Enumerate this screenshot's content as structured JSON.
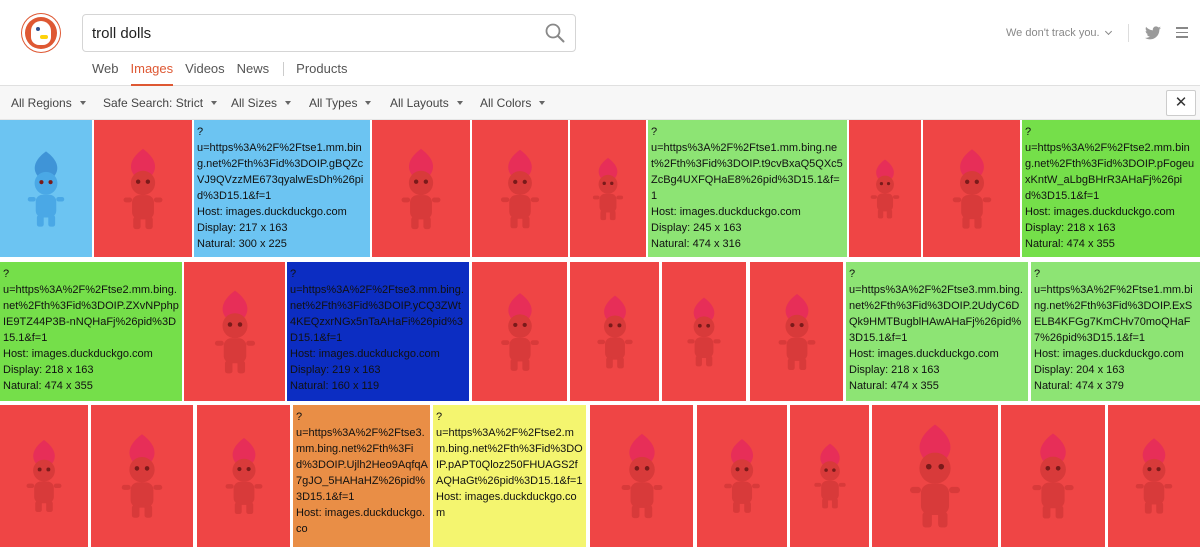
{
  "search": {
    "query": "troll dolls",
    "placeholder": ""
  },
  "header": {
    "track_text": "We don't track you."
  },
  "tabs": [
    {
      "label": "Web",
      "active": false
    },
    {
      "label": "Images",
      "active": true
    },
    {
      "label": "Videos",
      "active": false
    },
    {
      "label": "News",
      "active": false
    },
    {
      "label": "Products",
      "active": false
    }
  ],
  "filters": [
    {
      "label": "All Regions"
    },
    {
      "label": "Safe Search: Strict"
    },
    {
      "label": "All Sizes"
    },
    {
      "label": "All Types"
    },
    {
      "label": "All Layouts"
    },
    {
      "label": "All Colors"
    }
  ],
  "close_label": "✕",
  "colors": {
    "accent": "#de5833",
    "red": "#ef4545",
    "sky": "#6cc4f2",
    "green": "#8de474",
    "bright_green": "#75df4a",
    "blue": "#0c2dc2",
    "orange": "#e98e46",
    "yellow": "#f4f56f"
  },
  "images": [
    {
      "color": "sky",
      "troll": "blue"
    },
    {
      "color": "red"
    },
    {
      "color": "sky",
      "info": {
        "q": "?",
        "u": "u=https%3A%2F%2Ftse1.mm.bing.net%2Fth%3Fid%3DOIP.gBQZcVJ9QVzzME673qyalwEsDh%26pid%3D15.1&f=1",
        "host": "Host: images.duckduckgo.com",
        "display": "Display: 217 x 163",
        "natural": "Natural: 300 x 225"
      }
    },
    {
      "color": "red"
    },
    {
      "color": "red"
    },
    {
      "color": "red"
    },
    {
      "color": "green",
      "info": {
        "q": "?",
        "u": "u=https%3A%2F%2Ftse1.mm.bing.net%2Fth%3Fid%3DOIP.t9cvBxaQ5QXc5ZcBg4UXFQHaE8%26pid%3D15.1&f=1",
        "host": "Host: images.duckduckgo.com",
        "display": "Display: 245 x 163",
        "natural": "Natural: 474 x 316"
      }
    },
    {
      "color": "red"
    },
    {
      "color": "red"
    },
    {
      "color": "bright_green",
      "info": {
        "q": "?",
        "u": "u=https%3A%2F%2Ftse2.mm.bing.net%2Fth%3Fid%3DOIP.pFogeuxKntW_aLbgBHrR3AHaFj%26pid%3D15.1&f=1",
        "host": "Host: images.duckduckgo.com",
        "display": "Display: 218 x 163",
        "natural": "Natural: 474 x 355"
      }
    },
    {
      "color": "bright_green",
      "info": {
        "q": "?",
        "u": "u=https%3A%2F%2Ftse2.mm.bing.net%2Fth%3Fid%3DOIP.ZXvNPphpIE9TZ44P3B-nNQHaFj%26pid%3D15.1&f=1",
        "host": "Host: images.duckduckgo.com",
        "display": "Display: 218 x 163",
        "natural": "Natural: 474 x 355"
      }
    },
    {
      "color": "red"
    },
    {
      "color": "blue",
      "info": {
        "q": "?",
        "u": "u=https%3A%2F%2Ftse3.mm.bing.net%2Fth%3Fid%3DOIP.yCQ3ZWt4KEQzxrNGx5nTaAHaFi%26pid%3D15.1&f=1",
        "host": "Host: images.duckduckgo.com",
        "display": "Display: 219 x 163",
        "natural": "Natural: 160 x 119"
      }
    },
    {
      "color": "red"
    },
    {
      "color": "red"
    },
    {
      "color": "red"
    },
    {
      "color": "red"
    },
    {
      "color": "green",
      "info": {
        "q": "?",
        "u": "u=https%3A%2F%2Ftse3.mm.bing.net%2Fth%3Fid%3DOIP.2UdyC6DQk9HMTBugblHAwAHaFj%26pid%3D15.1&f=1",
        "host": "Host: images.duckduckgo.com",
        "display": "Display: 218 x 163",
        "natural": "Natural: 474 x 355"
      }
    },
    {
      "color": "green",
      "info": {
        "q": "?",
        "u": "u=https%3A%2F%2Ftse1.mm.bing.net%2Fth%3Fid%3DOIP.ExSELB4KFGg7KmCHv70moQHaF7%26pid%3D15.1&f=1",
        "host": "Host: images.duckduckgo.com",
        "display": "Display: 204 x 163",
        "natural": "Natural: 474 x 379"
      }
    },
    {
      "color": "red"
    },
    {
      "color": "red"
    },
    {
      "color": "red"
    },
    {
      "color": "orange",
      "info": {
        "q": "?",
        "u": "u=https%3A%2F%2Ftse3.mm.bing.net%2Fth%3Fid%3DOIP.Ujlh2Heo9AqfqA7gJO_5HAHaHZ%26pid%3D15.1&f=1",
        "host": "Host: images.duckduckgo.co"
      }
    },
    {
      "color": "yellow",
      "info": {
        "q": "?",
        "u": "u=https%3A%2F%2Ftse2.mm.bing.net%2Fth%3Fid%3DOIP.pAPT0Qloz250FHUAGS2fAQHaGt%26pid%3D15.1&f=1",
        "host": "Host: images.duckduckgo.com"
      }
    },
    {
      "color": "red"
    },
    {
      "color": "red"
    },
    {
      "color": "red"
    },
    {
      "color": "red"
    },
    {
      "color": "red"
    },
    {
      "color": "red"
    }
  ]
}
